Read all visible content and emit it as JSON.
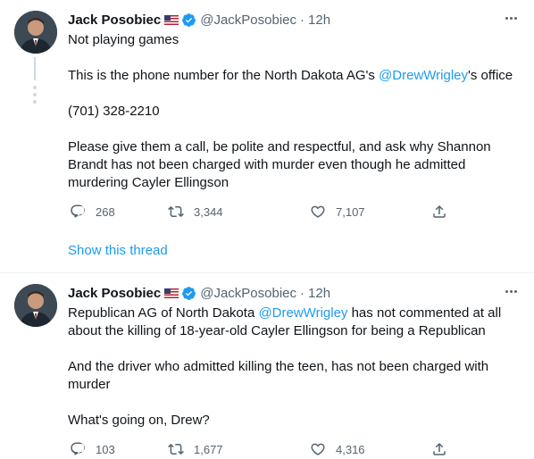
{
  "tweets": [
    {
      "author": {
        "name": "Jack Posobiec",
        "handle": "@JackPosobiec",
        "time": "12h"
      },
      "lines": [
        {
          "text": "Not playing games"
        },
        {
          "pre": "This is the phone number for the North Dakota AG's ",
          "mention": "@DrewWrigley",
          "post": "'s office"
        },
        {
          "text": "(701) 328-2210"
        },
        {
          "text": "Please give them a call, be polite and respectful, and ask why Shannon Brandt has not been charged with murder even though he admitted murdering Cayler Ellingson"
        }
      ],
      "counts": {
        "replies": "268",
        "retweets": "3,344",
        "likes": "7,107"
      },
      "show_thread": "Show this thread"
    },
    {
      "author": {
        "name": "Jack Posobiec",
        "handle": "@JackPosobiec",
        "time": "12h"
      },
      "lines": [
        {
          "pre": "Republican AG of North Dakota ",
          "mention": "@DrewWrigley",
          "post": " has not commented at all about the killing of 18-year-old Cayler Ellingson for being a Republican"
        },
        {
          "text": "And the driver who admitted killing the teen, has not been charged with murder"
        },
        {
          "text": "What's going on, Drew?"
        }
      ],
      "counts": {
        "replies": "103",
        "retweets": "1,677",
        "likes": "4,316"
      }
    }
  ],
  "colors": {
    "accent": "#1d9bf0",
    "secondary_text": "#536471",
    "verified": "#1d9bf0"
  },
  "icons": [
    "avatar",
    "us-flag-icon",
    "verified-badge-icon",
    "more-options-icon",
    "reply-icon",
    "retweet-icon",
    "like-icon",
    "share-icon"
  ]
}
